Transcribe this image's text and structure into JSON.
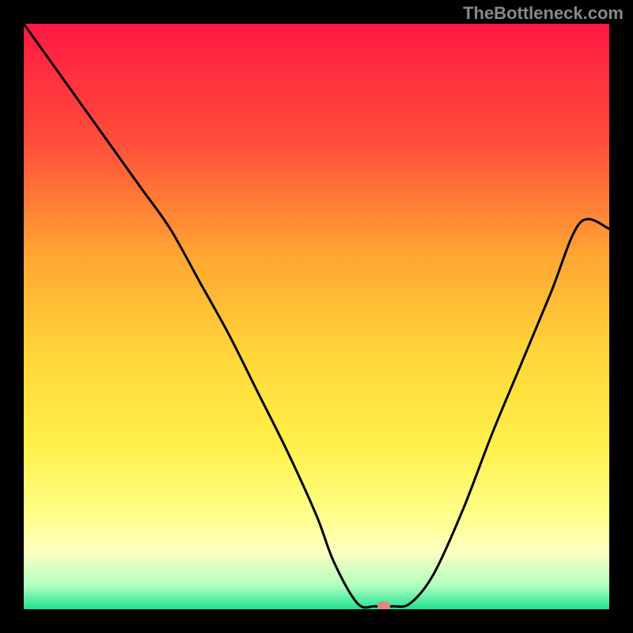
{
  "watermark": "TheBottleneck.com",
  "chart_data": {
    "type": "line",
    "title": "",
    "xlabel": "",
    "ylabel": "",
    "xlim": [
      0,
      100
    ],
    "ylim": [
      0,
      100
    ],
    "series": [
      {
        "name": "curve",
        "x": [
          0,
          5,
          10,
          15,
          20,
          25,
          30,
          35,
          40,
          45,
          50,
          53,
          57,
          60,
          63,
          66,
          70,
          75,
          80,
          85,
          90,
          95,
          100
        ],
        "y": [
          100,
          93,
          86,
          79,
          72,
          65,
          56,
          47,
          37,
          27,
          16,
          8,
          1,
          0.5,
          0.5,
          1,
          6,
          17,
          30,
          42,
          54,
          66,
          65
        ]
      }
    ],
    "marker": {
      "x": 61.5,
      "y": 0.5
    },
    "gradient_stops": [
      {
        "offset": 0,
        "color": "#ff1843"
      },
      {
        "offset": 20,
        "color": "#ff4d3a"
      },
      {
        "offset": 40,
        "color": "#ffa733"
      },
      {
        "offset": 58,
        "color": "#ffd93a"
      },
      {
        "offset": 72,
        "color": "#fff04a"
      },
      {
        "offset": 84,
        "color": "#ffff8a"
      },
      {
        "offset": 90,
        "color": "#ffffc0"
      },
      {
        "offset": 96,
        "color": "#b0ffc0"
      },
      {
        "offset": 100,
        "color": "#20e090"
      }
    ]
  }
}
